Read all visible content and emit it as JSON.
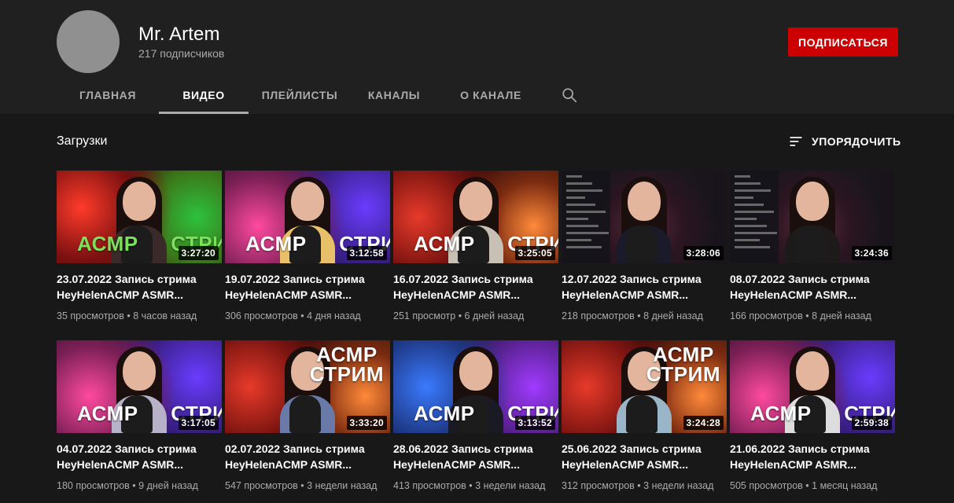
{
  "channel": {
    "name": "Mr. Artem",
    "subscribers": "217 подписчиков",
    "subscribe_label": "ПОДПИСАТЬСЯ"
  },
  "tabs": [
    {
      "label": "ГЛАВНАЯ",
      "active": false
    },
    {
      "label": "ВИДЕО",
      "active": true
    },
    {
      "label": "ПЛЕЙЛИСТЫ",
      "active": false
    },
    {
      "label": "КАНАЛЫ",
      "active": false
    },
    {
      "label": "О КАНАЛЕ",
      "active": false
    }
  ],
  "section": {
    "title": "Загрузки",
    "sort_label": "УПОРЯДОЧИТЬ"
  },
  "videos": [
    {
      "title_line1": "23.07.2022 Запись стрима",
      "title_line2": "HeyHelenACMP ASMR...",
      "views": "35 просмотров",
      "age": "8 часов назад",
      "duration": "3:27:20",
      "overlay_text": "АСМР СТРИМ",
      "theme": "red-green",
      "overlay_color": "#7de05a"
    },
    {
      "title_line1": "19.07.2022 Запись стрима",
      "title_line2": "HeyHelenACMP ASMR...",
      "views": "306 просмотров",
      "age": "4 дня назад",
      "duration": "3:12:58",
      "overlay_text": "АСМР СТРИМ",
      "theme": "purple-pink",
      "overlay_color": "#ffffff"
    },
    {
      "title_line1": "16.07.2022 Запись стрима",
      "title_line2": "HeyHelenACMP ASMR...",
      "views": "251 просмотр",
      "age": "6 дней назад",
      "duration": "3:25:05",
      "overlay_text": "АСМР СТРИМ",
      "theme": "red-dark",
      "overlay_color": "#ffffff"
    },
    {
      "title_line1": "12.07.2022 Запись стрима",
      "title_line2": "HeyHelenACMP ASMR...",
      "views": "218 просмотров",
      "age": "8 дней назад",
      "duration": "3:28:06",
      "overlay_text": "",
      "theme": "dark-chat",
      "overlay_color": "#ffffff"
    },
    {
      "title_line1": "08.07.2022 Запись стрима",
      "title_line2": "HeyHelenACMP ASMR...",
      "views": "166 просмотров",
      "age": "8 дней назад",
      "duration": "3:24:36",
      "overlay_text": "",
      "theme": "dark-chat",
      "overlay_color": "#ffffff"
    },
    {
      "title_line1": "04.07.2022 Запись стрима",
      "title_line2": "HeyHelenACMP ASMR...",
      "views": "180 просмотров",
      "age": "9 дней назад",
      "duration": "3:17:05",
      "overlay_text": "АСМР СТРИМ",
      "theme": "purple-pink",
      "overlay_color": "#ffffff"
    },
    {
      "title_line1": "02.07.2022 Запись стрима",
      "title_line2": "HeyHelenACMP ASMR...",
      "views": "547 просмотров",
      "age": "3 недели назад",
      "duration": "3:33:20",
      "overlay_text": "АСМР\nСТРИМ",
      "theme": "red-dark",
      "overlay_color": "#ffffff"
    },
    {
      "title_line1": "28.06.2022 Запись стрима",
      "title_line2": "HeyHelenACMP ASMR...",
      "views": "413 просмотров",
      "age": "3 недели назад",
      "duration": "3:13:52",
      "overlay_text": "АСМР СТРИМ",
      "theme": "blue-purple",
      "overlay_color": "#ffffff"
    },
    {
      "title_line1": "25.06.2022 Запись стрима",
      "title_line2": "HeyHelenACMP ASMR...",
      "views": "312 просмотров",
      "age": "3 недели назад",
      "duration": "3:24:28",
      "overlay_text": "АСМР\nСТРИМ",
      "theme": "red-dark",
      "overlay_color": "#ffffff"
    },
    {
      "title_line1": "21.06.2022 Запись стрима",
      "title_line2": "HeyHelenACMP ASMR...",
      "views": "505 просмотров",
      "age": "1 месяц назад",
      "duration": "2:59:38",
      "overlay_text": "АСМР СТРИМ",
      "theme": "purple-pink",
      "overlay_color": "#ffffff"
    }
  ],
  "icons": {
    "search": "search-icon",
    "sort": "sort-icon"
  },
  "colors": {
    "subscribe": "#cc0000",
    "header_bg": "#202020",
    "page_bg": "#181818"
  }
}
